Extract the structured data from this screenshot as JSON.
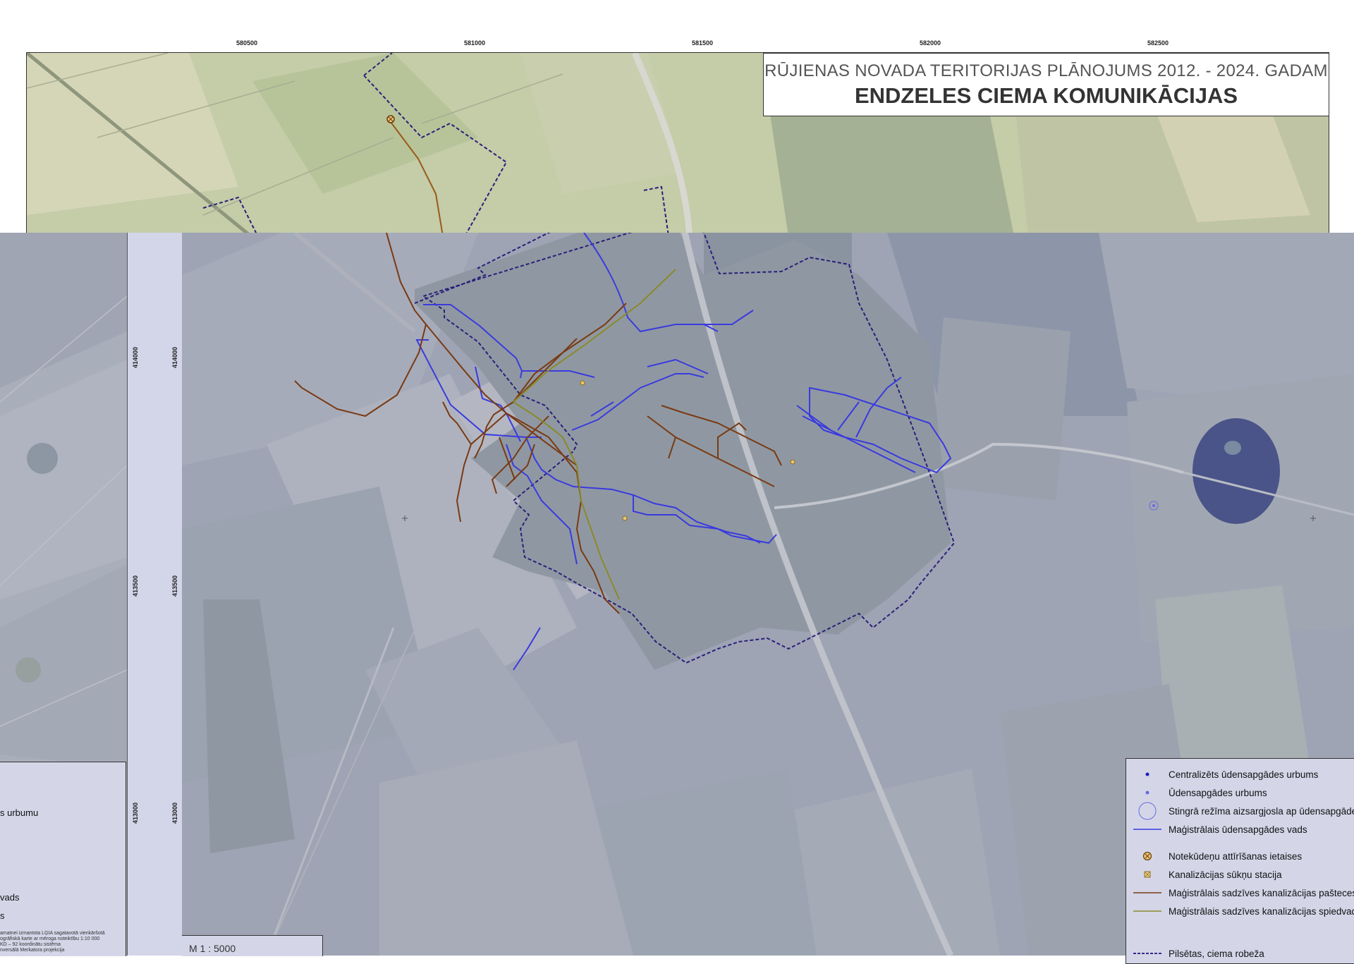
{
  "top_ticks": [
    "580500",
    "581000",
    "581500",
    "582000",
    "582500"
  ],
  "side_ticks": [
    "414000",
    "413500",
    "413000"
  ],
  "title": {
    "line1": "RŪJIENAS NOVADA TERITORIJAS PLĀNOJUMS 2012. - 2024. GADAM",
    "line2": "ENDZELES CIEMA KOMUNIKĀCIJAS"
  },
  "legend": {
    "items": [
      {
        "label": "Centralizēts ūdensapgādes urbums",
        "symbol": "dot-blue-dark",
        "color": "#1d1dbf"
      },
      {
        "label": "Ūdensapgādes urbums",
        "symbol": "dot-blue-light",
        "color": "#6a6ae0"
      },
      {
        "label": "Stingrā režīma aizsargjosla ap ūdensapgādes",
        "symbol": "circle-outline",
        "color": "#6a6ae0"
      },
      {
        "label": "Maģistrālais ūdensapgādes vads",
        "symbol": "line-blue",
        "color": "#3a3adf"
      },
      {
        "label": "Notekūdeņu attīrīšanas ietaises",
        "symbol": "circle-cross",
        "color": "#6b3b10"
      },
      {
        "label": "Kanalizācijas sūkņu stacija",
        "symbol": "square-cross",
        "color": "#c8a23a"
      },
      {
        "label": "Maģistrālais sadzīves kanalizācijas pašteces",
        "symbol": "line-brown",
        "color": "#7a3a12"
      },
      {
        "label": "Maģistrālais sadzīves kanalizācijas spiedvad",
        "symbol": "line-olive",
        "color": "#8a8a2a"
      },
      {
        "label": "Pilsētas, ciema robeža",
        "symbol": "line-dash",
        "color": "#3a2a8a"
      }
    ]
  },
  "left_legend": {
    "items": [
      "s urbumu",
      "vads",
      "s"
    ],
    "notes": [
      "amatnei izmantota LĢIA sagatavotā vienkāršotā",
      "ogrāfiskā karte ar mēroga noteiktību 1:10 000",
      "KD – 92 koordinātu sistēma",
      "nversālā Merkatora projekcija"
    ]
  },
  "scale": "M 1 : 5000",
  "colors": {
    "water": "#3a3adf",
    "sewer_gravity": "#7a3a12",
    "sewer_pressure": "#8a8a2a",
    "boundary": "#3a2a8a"
  }
}
